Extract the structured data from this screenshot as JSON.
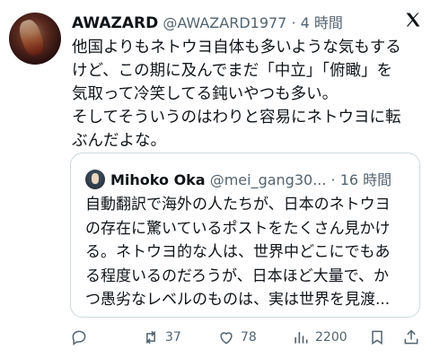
{
  "tweet": {
    "author_name": "AWAZARD",
    "handle_time": "@AWAZARD1977 · 4 時間",
    "text": "他国よりもネトウヨ自体も多いような気もする\nけど、この期に及んでまだ「中立」「俯瞰」を\n気取って冷笑してる鈍いやつも多い。\nそしてそういうのはわりと容易にネトウヨに転\nぶんだよな。"
  },
  "quote": {
    "author_name": "Mihoko Oka",
    "handle_time": "@mei_gang30... · 16 時間",
    "text": "自動翻訳で海外の人たちが、日本のネトウヨ\nの存在に驚いているポストをたくさん見かけ\nる。ネトウヨ的な人は、世界中どこにでもあ\nる程度いるのだろうが、日本ほど大量で、か\nつ愚劣なレベルのものは、実は世界を見渡..."
  },
  "actions": {
    "reply_icon": "reply-icon",
    "retweet_count": "37",
    "like_count": "78",
    "views_count": "2200",
    "bookmark_icon": "bookmark-icon",
    "share_icon": "share-icon"
  }
}
